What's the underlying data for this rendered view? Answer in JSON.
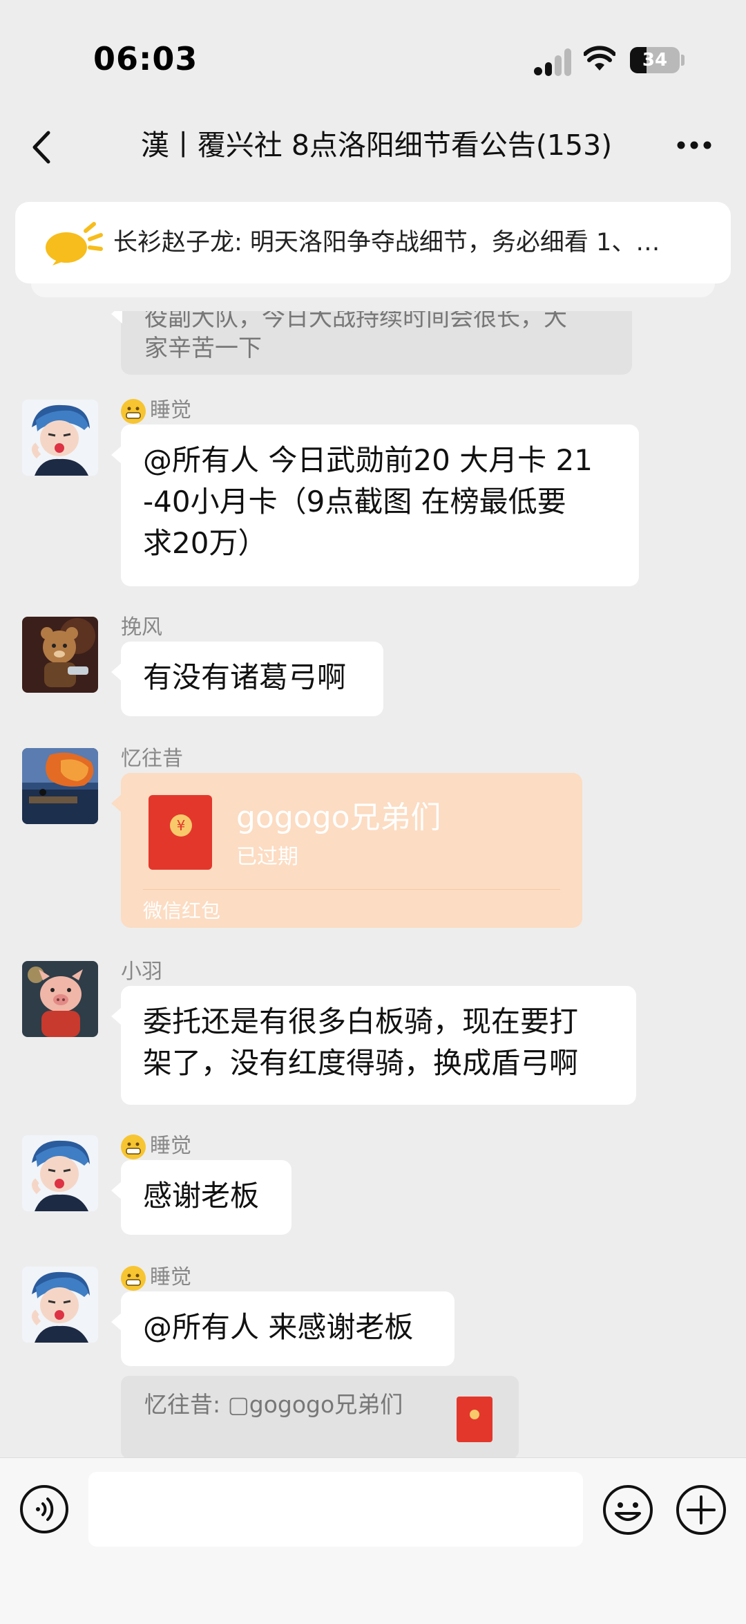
{
  "status_bar": {
    "time": "06:03",
    "battery": "34",
    "battery_level": 0.34
  },
  "nav": {
    "back_icon": "chevron-left-icon",
    "title": "漢丨覆兴社 8点洛阳细节看公告(153)",
    "more_icon": "more-dots-icon"
  },
  "announcement": {
    "icon": "megaphone-icon",
    "text": "长衫赵子龙: 明天洛阳争夺战细节，务必细看 1、…"
  },
  "messages": [
    {
      "type": "partial_text",
      "text_line1": "役副大队，今日大战持续时间会很长，大",
      "text_line2": "家辛苦一下"
    },
    {
      "type": "text",
      "sender": "睡觉",
      "sender_emoji": "grinning-face-icon",
      "text_line1": "@所有人 今日武勋前20 大月卡 21",
      "text_line2": "-40小月卡（9点截图 在榜最低要",
      "text_line3": "求20万）"
    },
    {
      "type": "text",
      "sender": "挽风",
      "text_line1": "有没有诸葛弓啊"
    },
    {
      "type": "red_packet",
      "sender": "忆往昔",
      "title": "gogogo兄弟们",
      "status": "已过期",
      "footer": "微信红包"
    },
    {
      "type": "text",
      "sender": "小羽",
      "text_line1": "委托还是有很多白板骑，现在要打",
      "text_line2": "架了，没有红度得骑，换成盾弓啊"
    },
    {
      "type": "text",
      "sender": "睡觉",
      "sender_emoji": "grinning-face-icon",
      "text_line1": "感谢老板"
    },
    {
      "type": "text",
      "sender": "睡觉",
      "sender_emoji": "grinning-face-icon",
      "text_line1": "@所有人 来感谢老板",
      "quote": "忆往昔: ▢gogogo兄弟们"
    }
  ],
  "input_bar": {
    "voice_icon": "voice-icon",
    "input_value": "",
    "emoji_icon": "emoji-icon",
    "plus_icon": "plus-icon"
  }
}
